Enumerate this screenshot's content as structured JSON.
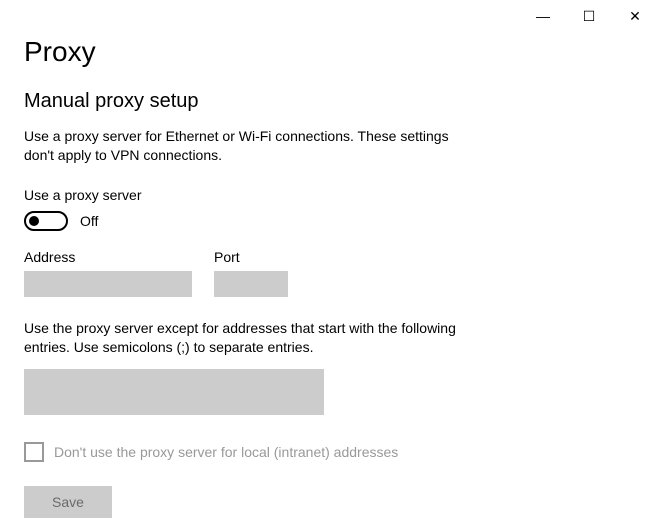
{
  "window": {
    "minimize_glyph": "—",
    "maximize_glyph": "☐",
    "close_glyph": "✕"
  },
  "page": {
    "title": "Proxy",
    "section_title": "Manual proxy setup",
    "description": "Use a proxy server for Ethernet or Wi-Fi connections. These settings don't apply to VPN connections."
  },
  "toggle": {
    "label": "Use a proxy server",
    "state": "Off"
  },
  "fields": {
    "address_label": "Address",
    "address_value": "",
    "port_label": "Port",
    "port_value": ""
  },
  "exceptions": {
    "description": "Use the proxy server except for addresses that start with the following entries. Use semicolons (;) to separate entries.",
    "value": ""
  },
  "checkbox": {
    "label": "Don't use the proxy server for local (intranet) addresses"
  },
  "buttons": {
    "save": "Save"
  }
}
